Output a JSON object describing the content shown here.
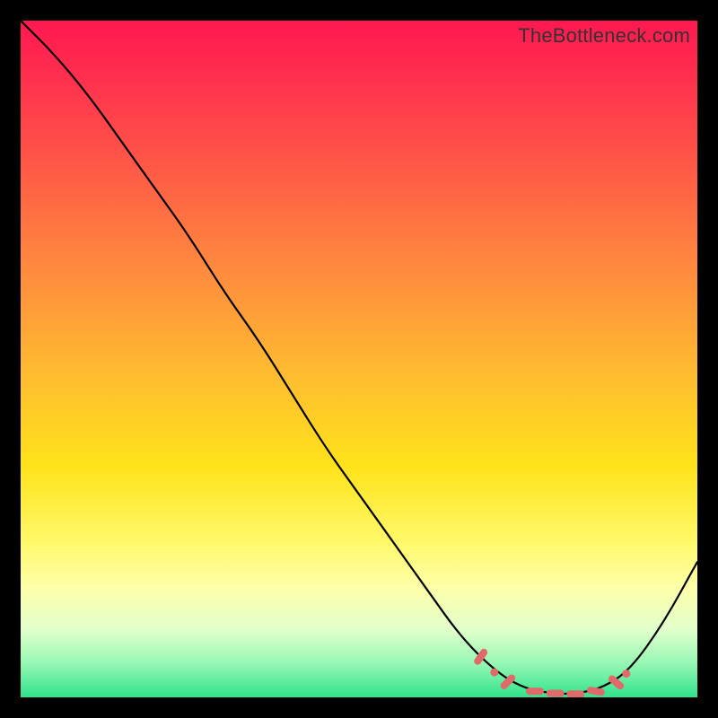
{
  "watermark": "TheBottleneck.com",
  "chart_data": {
    "type": "line",
    "title": "",
    "xlabel": "",
    "ylabel": "",
    "xlim": [
      0,
      100
    ],
    "ylim": [
      0,
      100
    ],
    "curve": [
      {
        "x": 0,
        "y": 100
      },
      {
        "x": 5,
        "y": 95
      },
      {
        "x": 10,
        "y": 89
      },
      {
        "x": 15,
        "y": 82
      },
      {
        "x": 20,
        "y": 75
      },
      {
        "x": 25,
        "y": 68
      },
      {
        "x": 30,
        "y": 60
      },
      {
        "x": 35,
        "y": 53
      },
      {
        "x": 40,
        "y": 45
      },
      {
        "x": 45,
        "y": 37
      },
      {
        "x": 50,
        "y": 30
      },
      {
        "x": 55,
        "y": 23
      },
      {
        "x": 60,
        "y": 16
      },
      {
        "x": 65,
        "y": 9
      },
      {
        "x": 70,
        "y": 4
      },
      {
        "x": 74,
        "y": 1.5
      },
      {
        "x": 78,
        "y": 0.6
      },
      {
        "x": 82,
        "y": 0.5
      },
      {
        "x": 86,
        "y": 1.4
      },
      {
        "x": 90,
        "y": 4
      },
      {
        "x": 95,
        "y": 11
      },
      {
        "x": 100,
        "y": 20
      }
    ],
    "markers": [
      {
        "x": 68,
        "y": 6,
        "shape": "pill",
        "angle": -55
      },
      {
        "x": 70,
        "y": 3.7,
        "shape": "dot"
      },
      {
        "x": 72,
        "y": 2.3,
        "shape": "pill",
        "angle": -45
      },
      {
        "x": 76,
        "y": 0.9,
        "shape": "pill",
        "angle": 0
      },
      {
        "x": 79,
        "y": 0.6,
        "shape": "pill",
        "angle": 0
      },
      {
        "x": 82,
        "y": 0.5,
        "shape": "pill",
        "angle": 0
      },
      {
        "x": 85,
        "y": 0.9,
        "shape": "pill",
        "angle": 10
      },
      {
        "x": 88,
        "y": 2.2,
        "shape": "pill",
        "angle": 40
      },
      {
        "x": 89.5,
        "y": 3.5,
        "shape": "dot"
      }
    ],
    "gradient_stops": [
      {
        "pos": 0,
        "color": "#ff1850"
      },
      {
        "pos": 100,
        "color": "#2fe38c"
      }
    ]
  }
}
